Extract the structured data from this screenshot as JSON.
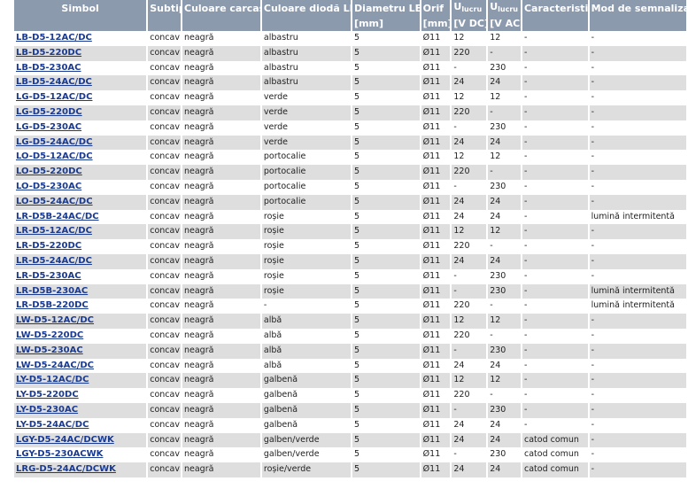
{
  "table": {
    "headers_row1": [
      {
        "label": "Simbol"
      },
      {
        "label": "Subtip"
      },
      {
        "label": "Culoare carcasă"
      },
      {
        "label": "Culoare diodă LED"
      },
      {
        "label": "Diametru LED"
      },
      {
        "label": "Orif"
      },
      {
        "label": "U",
        "sub": "lucru"
      },
      {
        "label": "U",
        "sub": "lucru"
      },
      {
        "label": "Caracteristici"
      },
      {
        "label": "Mod de semnalizare"
      }
    ],
    "headers_row2": [
      "",
      "",
      "",
      "",
      "[mm]",
      "[mm]",
      "[V DC]",
      "[V AC]",
      "",
      ""
    ],
    "rows": [
      [
        "LB-D5-12AC/DC",
        "concav",
        "neagră",
        "albastru",
        "5",
        "Ø11",
        "12",
        "12",
        "-",
        "-"
      ],
      [
        "LB-D5-220DC",
        "concav",
        "neagră",
        "albastru",
        "5",
        "Ø11",
        "220",
        "-",
        "-",
        "-"
      ],
      [
        "LB-D5-230AC",
        "concav",
        "neagră",
        "albastru",
        "5",
        "Ø11",
        "-",
        "230",
        "-",
        "-"
      ],
      [
        "LB-D5-24AC/DC",
        "concav",
        "neagră",
        "albastru",
        "5",
        "Ø11",
        "24",
        "24",
        "-",
        "-"
      ],
      [
        "LG-D5-12AC/DC",
        "concav",
        "neagră",
        "verde",
        "5",
        "Ø11",
        "12",
        "12",
        "-",
        "-"
      ],
      [
        "LG-D5-220DC",
        "concav",
        "neagră",
        "verde",
        "5",
        "Ø11",
        "220",
        "-",
        "-",
        "-"
      ],
      [
        "LG-D5-230AC",
        "concav",
        "neagră",
        "verde",
        "5",
        "Ø11",
        "-",
        "230",
        "-",
        "-"
      ],
      [
        "LG-D5-24AC/DC",
        "concav",
        "neagră",
        "verde",
        "5",
        "Ø11",
        "24",
        "24",
        "-",
        "-"
      ],
      [
        "LO-D5-12AC/DC",
        "concav",
        "neagră",
        "portocalie",
        "5",
        "Ø11",
        "12",
        "12",
        "-",
        "-"
      ],
      [
        "LO-D5-220DC",
        "concav",
        "neagră",
        "portocalie",
        "5",
        "Ø11",
        "220",
        "-",
        "-",
        "-"
      ],
      [
        "LO-D5-230AC",
        "concav",
        "neagră",
        "portocalie",
        "5",
        "Ø11",
        "-",
        "230",
        "-",
        "-"
      ],
      [
        "LO-D5-24AC/DC",
        "concav",
        "neagră",
        "portocalie",
        "5",
        "Ø11",
        "24",
        "24",
        "-",
        "-"
      ],
      [
        "LR-D5B-24AC/DC",
        "concav",
        "neagră",
        "roșie",
        "5",
        "Ø11",
        "24",
        "24",
        "-",
        "lumină intermitentă"
      ],
      [
        "LR-D5-12AC/DC",
        "concav",
        "neagră",
        "roșie",
        "5",
        "Ø11",
        "12",
        "12",
        "-",
        "-"
      ],
      [
        "LR-D5-220DC",
        "concav",
        "neagră",
        "roșie",
        "5",
        "Ø11",
        "220",
        "-",
        "-",
        "-"
      ],
      [
        "LR-D5-24AC/DC",
        "concav",
        "neagră",
        "roșie",
        "5",
        "Ø11",
        "24",
        "24",
        "-",
        "-"
      ],
      [
        "LR-D5-230AC",
        "concav",
        "neagră",
        "roșie",
        "5",
        "Ø11",
        "-",
        "230",
        "-",
        "-"
      ],
      [
        "LR-D5B-230AC",
        "concav",
        "neagră",
        "roșie",
        "5",
        "Ø11",
        "-",
        "230",
        "-",
        "lumină intermitentă"
      ],
      [
        "LR-D5B-220DC",
        "concav",
        "neagră",
        "-",
        "5",
        "Ø11",
        "220",
        "-",
        "-",
        "lumină intermitentă"
      ],
      [
        "LW-D5-12AC/DC",
        "concav",
        "neagră",
        "albă",
        "5",
        "Ø11",
        "12",
        "12",
        "-",
        "-"
      ],
      [
        "LW-D5-220DC",
        "concav",
        "neagră",
        "albă",
        "5",
        "Ø11",
        "220",
        "-",
        "-",
        "-"
      ],
      [
        "LW-D5-230AC",
        "concav",
        "neagră",
        "albă",
        "5",
        "Ø11",
        "-",
        "230",
        "-",
        "-"
      ],
      [
        "LW-D5-24AC/DC",
        "concav",
        "neagră",
        "albă",
        "5",
        "Ø11",
        "24",
        "24",
        "-",
        "-"
      ],
      [
        "LY-D5-12AC/DC",
        "concav",
        "neagră",
        "galbenă",
        "5",
        "Ø11",
        "12",
        "12",
        "-",
        "-"
      ],
      [
        "LY-D5-220DC",
        "concav",
        "neagră",
        "galbenă",
        "5",
        "Ø11",
        "220",
        "-",
        "-",
        "-"
      ],
      [
        "LY-D5-230AC",
        "concav",
        "neagră",
        "galbenă",
        "5",
        "Ø11",
        "-",
        "230",
        "-",
        "-"
      ],
      [
        "LY-D5-24AC/DC",
        "concav",
        "neagră",
        "galbenă",
        "5",
        "Ø11",
        "24",
        "24",
        "-",
        "-"
      ],
      [
        "LGY-D5-24AC/DCWK",
        "concav",
        "neagră",
        "galben/verde",
        "5",
        "Ø11",
        "24",
        "24",
        "catod comun",
        "-"
      ],
      [
        "LGY-D5-230ACWK",
        "concav",
        "neagră",
        "galben/verde",
        "5",
        "Ø11",
        "-",
        "230",
        "catod comun",
        "-"
      ],
      [
        "LRG-D5-24AC/DCWK",
        "concav",
        "neagră",
        "roșie/verde",
        "5",
        "Ø11",
        "24",
        "24",
        "catod comun",
        "-"
      ]
    ]
  }
}
